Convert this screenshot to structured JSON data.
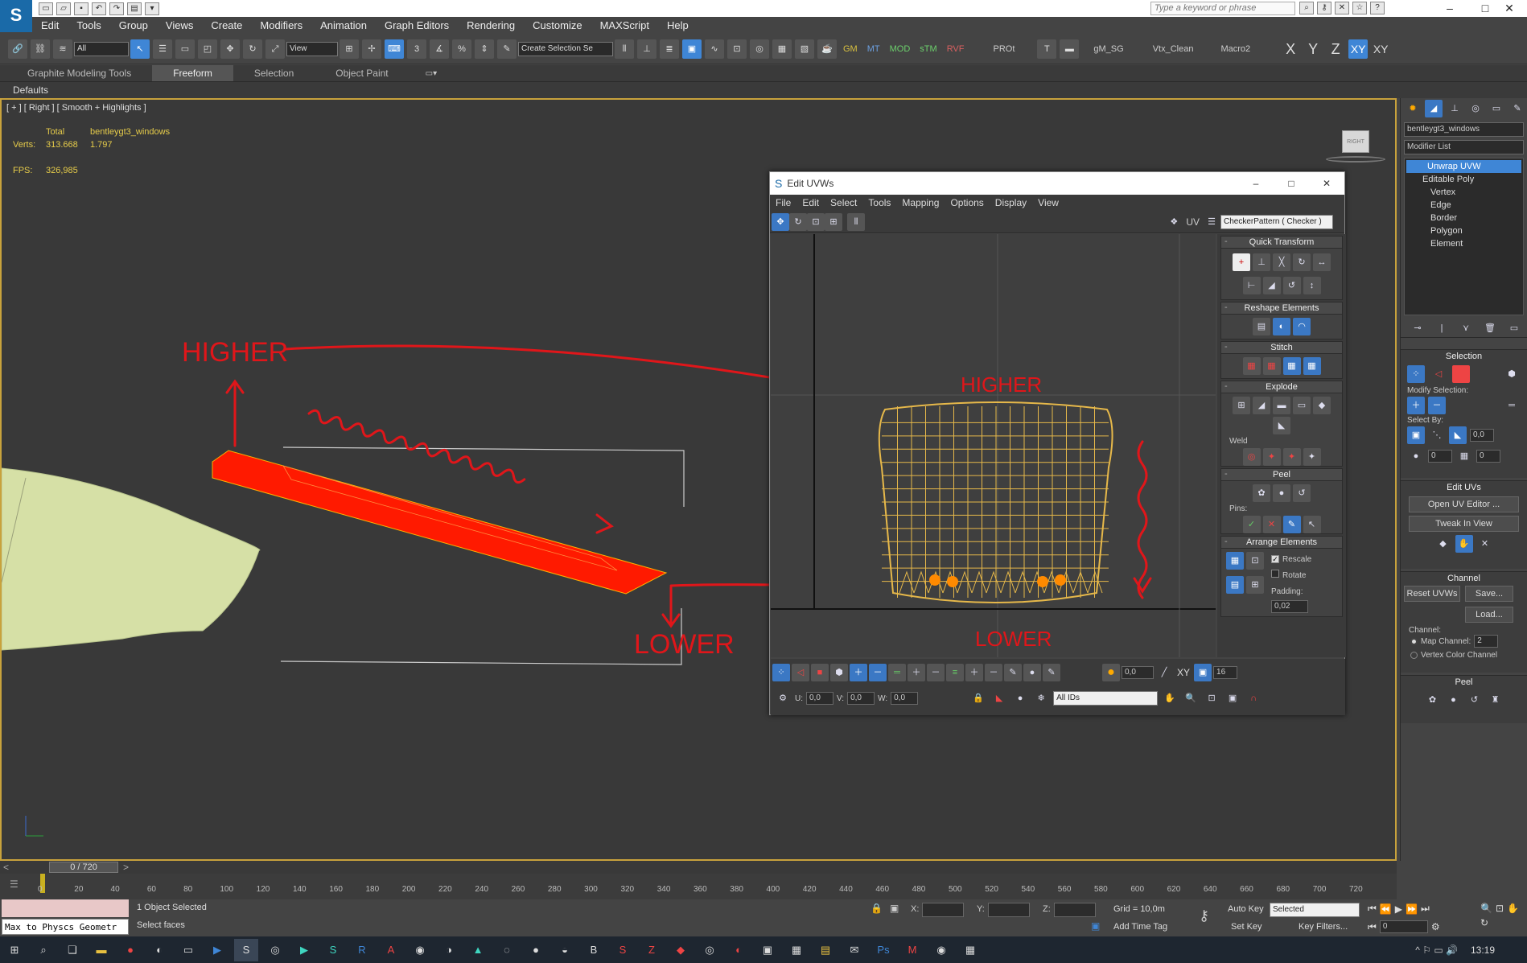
{
  "title": {
    "search_placeholder": "Type a keyword or phrase",
    "min": "–",
    "max": "□",
    "close": "✕"
  },
  "menu": [
    "Edit",
    "Tools",
    "Group",
    "Views",
    "Create",
    "Modifiers",
    "Animation",
    "Graph Editors",
    "Rendering",
    "Customize",
    "MAXScript",
    "Help"
  ],
  "toolbar": {
    "selection_filter": "All",
    "ref_coord": "View",
    "create_selection_set": "Create Selection Se",
    "snap_label": "3",
    "text_buttons": [
      "GM",
      "MT",
      "MOD",
      "sTM",
      "RVF",
      "PROt",
      "gM_SG",
      "Vtx_Clean",
      "Macro2"
    ],
    "axes": [
      "X",
      "Y",
      "Z",
      "XY",
      "XY"
    ]
  },
  "ribbon": {
    "tabs": [
      "Graphite Modeling Tools",
      "Freeform",
      "Selection",
      "Object Paint"
    ],
    "active": "Freeform",
    "defaults": "Defaults"
  },
  "viewport": {
    "label": "[ + ] [ Right ] [ Smooth + Highlights ]",
    "stats_total": "Total",
    "stats_object": "bentleygt3_windows",
    "verts_label": "Verts:",
    "verts_total": "313.668",
    "verts_object": "1.797",
    "fps_label": "FPS:",
    "fps": "326,985",
    "viewcube": "RIGHT",
    "annot_higher": "HIGHER",
    "annot_lower": "LOWER"
  },
  "uvw": {
    "title": "Edit UVWs",
    "menu": [
      "File",
      "Edit",
      "Select",
      "Tools",
      "Mapping",
      "Options",
      "Display",
      "View"
    ],
    "uv_label": "UV",
    "texture": "CheckerPattern ( Checker )",
    "annot_higher": "HIGHER",
    "annot_lower": "LOWER",
    "quick_transform": "Quick Transform",
    "reshape": "Reshape Elements",
    "stitch": "Stitch",
    "explode": "Explode",
    "weld": "Weld",
    "peel": "Peel",
    "pins": "Pins:",
    "arrange": "Arrange Elements",
    "rescale": "Rescale",
    "rotate": "Rotate",
    "padding": "Padding:",
    "padding_val": "0,02",
    "softsel_val": "0,0",
    "xy_label": "XY",
    "grid_val": "16",
    "u_label": "U:",
    "u_val": "0,0",
    "v_label": "V:",
    "v_val": "0,0",
    "w_label": "W:",
    "w_val": "0,0",
    "ids": "All IDs"
  },
  "cmd": {
    "object_name": "bentleygt3_windows",
    "modifier_list": "Modifier List",
    "stack": [
      "Unwrap UVW",
      "Editable Poly",
      "Vertex",
      "Edge",
      "Border",
      "Polygon",
      "Element"
    ],
    "selection": "Selection",
    "modify_selection": "Modify Selection:",
    "select_by": "Select By:",
    "angle_val": "0,0",
    "val0": "0",
    "val0b": "0",
    "edit_uvs": "Edit UVs",
    "open_uv_editor": "Open UV Editor ...",
    "tweak_in_view": "Tweak In View",
    "channel": "Channel",
    "reset_uvws": "Reset UVWs",
    "save": "Save...",
    "load": "Load...",
    "channel_label": "Channel:",
    "map_channel": "Map Channel:",
    "map_channel_val": "2",
    "vertex_color_channel": "Vertex Color Channel",
    "peel": "Peel"
  },
  "timeline": {
    "frame": "0 / 720",
    "ticks": [
      "0",
      "20",
      "40",
      "60",
      "80",
      "100",
      "120",
      "140",
      "160",
      "180",
      "200",
      "220",
      "240",
      "260",
      "280",
      "300",
      "320",
      "340",
      "360",
      "380",
      "400",
      "420",
      "440",
      "460",
      "480",
      "500",
      "520",
      "540",
      "560",
      "580",
      "600",
      "620",
      "640",
      "660",
      "680",
      "700",
      "720"
    ]
  },
  "status": {
    "script_listener": "Max to Physcs Geometr",
    "objects_selected": "1 Object Selected",
    "prompt": "Select faces",
    "x_label": "X:",
    "y_label": "Y:",
    "z_label": "Z:",
    "grid": "Grid = 10,0m",
    "add_time_tag": "Add Time Tag",
    "auto_key": "Auto Key",
    "set_key": "Set Key",
    "selected": "Selected",
    "key_filters": "Key Filters...",
    "frame_val": "0"
  },
  "taskbar": {
    "time": "13:19"
  },
  "colors": {
    "accent": "#3f86d6",
    "annotation": "#e0161a",
    "viewport_border": "#c8a23c",
    "uv_mesh": "#e6b84a",
    "selected_mesh": "#ff1a00",
    "ground_mesh": "#d6e0a6"
  }
}
